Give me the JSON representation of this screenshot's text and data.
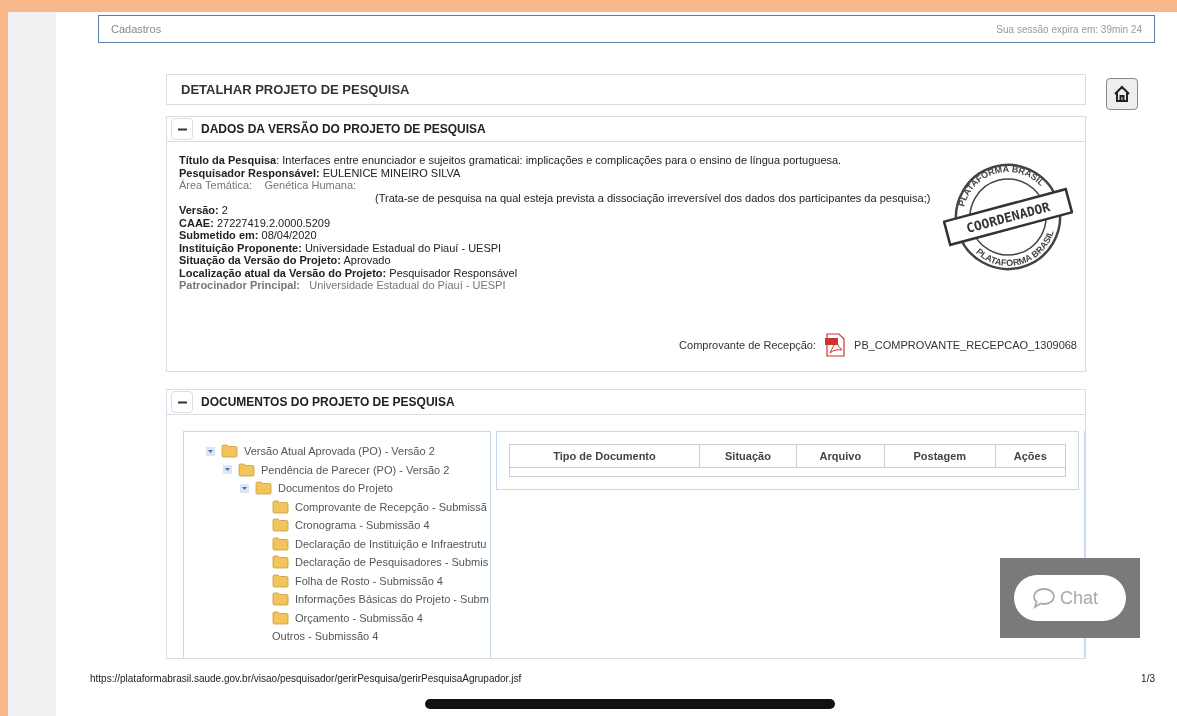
{
  "header": {
    "title": "Cadastros",
    "session": "Sua sessão expira em: 39min 24"
  },
  "page_title": "DETALHAR PROJETO DE PESQUISA",
  "version_section": {
    "title": "DADOS DA VERSÃO DO PROJETO DE PESQUISA",
    "expanded": true,
    "fields": [
      {
        "text": "**Título da Pesquisa**: Interfaces entre enunciador e sujeitos gramaticai: implicações e complicações para o ensino de língua portuguesa.",
        "muted": false
      },
      {
        "text": "**Pesquisador Responsável:** EULENICE MINEIRO SILVA",
        "muted": false
      },
      {
        "text": "Área Temática:    Genética Humana:",
        "muted": true
      },
      {
        "text": "(Trata-se de pesquisa na qual esteja prevista a dissociação irreversível dos dados dos participantes da pesquisa;)",
        "muted": false,
        "kind": "note"
      },
      {
        "text": "**Versão:** 2",
        "muted": false
      },
      {
        "text": "**CAAE:** 27227419.2.0000.5209",
        "muted": false
      },
      {
        "text": "**Submetido em:** 08/04/2020",
        "muted": false
      },
      {
        "text": "**Instituição Proponente:** Universidade Estadual do Piauí - UESPI",
        "muted": false
      },
      {
        "text": "**Situação da Versão do Projeto:** Aprovado",
        "muted": false
      },
      {
        "text": "**Localização atual da Versão do Projeto:** Pesquisador Responsável",
        "muted": false
      },
      {
        "text": "**Patrocinador Principal:**   Universidade Estadual do Piauí - UESPI",
        "muted": true
      }
    ],
    "stamp": {
      "ring_top": "PLATAFORMA BRASIL",
      "ring_bottom": "PLATAFORMA BRASIL",
      "label": "COORDENADOR"
    },
    "receipt": {
      "label": "Comprovante de Recepção:",
      "file": "PB_COMPROVANTE_RECEPCAO_1309068"
    }
  },
  "documents_section": {
    "title": "DOCUMENTOS DO PROJETO DE PESQUISA",
    "expanded": true,
    "tree": [
      {
        "label": "Versão Atual Aprovada (PO) - Versão 2",
        "kind": "folder",
        "expanded": true,
        "children": [
          {
            "label": "Pendência de Parecer (PO) - Versão 2",
            "kind": "folder",
            "expanded": true,
            "children": [
              {
                "label": "Documentos do Projeto",
                "kind": "folder",
                "expanded": true,
                "children": [
                  {
                    "label": "Comprovante de Recepção - Submissã",
                    "kind": "folder"
                  },
                  {
                    "label": "Cronograma - Submissão 4",
                    "kind": "folder"
                  },
                  {
                    "label": "Declaração de Instituição e Infraestrutu",
                    "kind": "folder"
                  },
                  {
                    "label": "Declaração de Pesquisadores - Submis",
                    "kind": "folder"
                  },
                  {
                    "label": "Folha de Rosto - Submissão 4",
                    "kind": "folder"
                  },
                  {
                    "label": "Informações Básicas do Projeto - Subm",
                    "kind": "folder"
                  },
                  {
                    "label": "Orçamento - Submissão 4",
                    "kind": "folder"
                  },
                  {
                    "label": "Outros - Submissão 4",
                    "kind": "plain"
                  }
                ]
              }
            ]
          }
        ]
      }
    ],
    "table": {
      "columns": [
        "Tipo de Documento",
        "Situação",
        "Arquivo",
        "Postagem",
        "Ações"
      ]
    }
  },
  "chat": {
    "label": "Chat"
  },
  "footer": {
    "url": "https://plataformabrasil.saude.gov.br/visao/pesquisador/gerirPesquisa/gerirPesquisaAgrupador.jsf",
    "page": "1/3"
  }
}
